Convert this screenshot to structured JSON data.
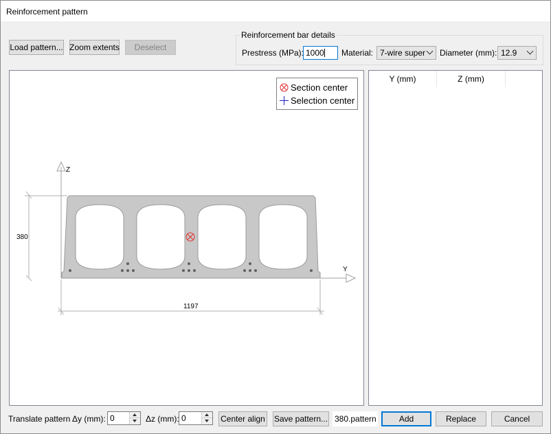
{
  "window": {
    "title": "Reinforcement pattern"
  },
  "toolbar": {
    "load_label": "Load pattern...",
    "zoom_label": "Zoom extents",
    "deselect_label": "Deselect"
  },
  "bar_details": {
    "group_title": "Reinforcement bar details",
    "prestress_label": "Prestress (MPa):",
    "prestress_value": "1000",
    "material_label": "Material:",
    "material_value": "7-wire super",
    "diameter_label": "Diameter (mm):",
    "diameter_value": "12.9"
  },
  "canvas": {
    "legend": {
      "section_center": "Section center",
      "selection_center": "Selection center"
    },
    "axis_z": "Z",
    "axis_y": "Y",
    "height_dim": "380",
    "width_dim": "1197"
  },
  "table": {
    "columns": [
      "Y (mm)",
      "Z (mm)"
    ],
    "rows": []
  },
  "bottom": {
    "translate_label": "Translate pattern",
    "dy_label": "Δy (mm):",
    "dy_value": "0",
    "dz_label": "Δz (mm):",
    "dz_value": "0",
    "center_align_label": "Center align",
    "save_label": "Save pattern...",
    "pattern_file": "380.pattern",
    "add_label": "Add",
    "replace_label": "Replace",
    "cancel_label": "Cancel"
  },
  "colors": {
    "accent": "#0078d7",
    "section_center_marker": "#e03030",
    "selection_center_marker": "#2020c0",
    "slab_fill": "#c8c8c8"
  }
}
